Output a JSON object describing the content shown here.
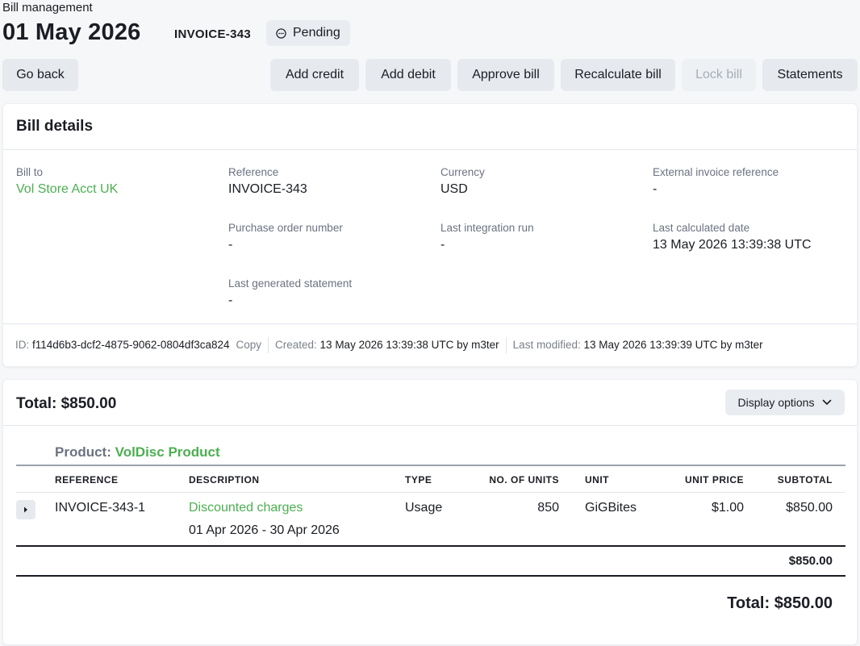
{
  "header": {
    "breadcrumb": "Bill management",
    "title": "01 May 2026",
    "invoice_tag": "INVOICE-343",
    "status": "Pending"
  },
  "toolbar": {
    "go_back": "Go back",
    "add_credit": "Add credit",
    "add_debit": "Add debit",
    "approve_bill": "Approve bill",
    "recalculate_bill": "Recalculate bill",
    "lock_bill": "Lock bill",
    "statements": "Statements"
  },
  "details": {
    "heading": "Bill details",
    "bill_to_label": "Bill to",
    "bill_to_value": "Vol Store Acct UK",
    "reference_label": "Reference",
    "reference_value": "INVOICE-343",
    "currency_label": "Currency",
    "currency_value": "USD",
    "ext_ref_label": "External invoice reference",
    "ext_ref_value": "-",
    "po_label": "Purchase order number",
    "po_value": "-",
    "last_integration_label": "Last integration run",
    "last_integration_value": "-",
    "last_calculated_label": "Last calculated date",
    "last_calculated_value": "13 May 2026 13:39:38 UTC",
    "last_statement_label": "Last generated statement",
    "last_statement_value": "-"
  },
  "meta": {
    "id_label": "ID:",
    "id_value": "f114d6b3-dcf2-4875-9062-0804df3ca824",
    "copy": "Copy",
    "created_label": "Created:",
    "created_value": "13 May 2026 13:39:38 UTC by m3ter",
    "modified_label": "Last modified:",
    "modified_value": "13 May 2026 13:39:39 UTC by m3ter"
  },
  "lines": {
    "total_heading": "Total: $850.00",
    "display_options": "Display options",
    "product_label": "Product:",
    "product_name": "VolDisc Product",
    "columns": [
      "REFERENCE",
      "DESCRIPTION",
      "TYPE",
      "NO. OF UNITS",
      "UNIT",
      "UNIT PRICE",
      "SUBTOTAL"
    ],
    "rows": [
      {
        "reference": "INVOICE-343-1",
        "description": "Discounted charges",
        "period": "01 Apr 2026 - 30 Apr 2026",
        "type": "Usage",
        "units": "850",
        "unit": "GiGBites",
        "unit_price": "$1.00",
        "subtotal": "$850.00"
      }
    ],
    "product_subtotal": "$850.00",
    "grand_total": "Total: $850.00"
  },
  "colors": {
    "accent_green": "#4caf50",
    "button_bg": "#e6eaef"
  }
}
